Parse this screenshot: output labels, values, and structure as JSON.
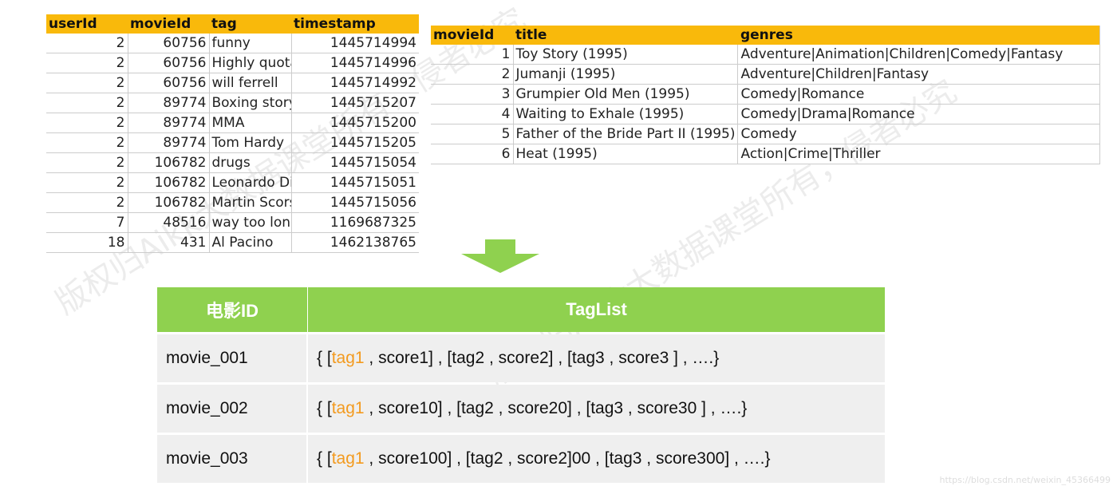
{
  "tags_table": {
    "headers": [
      "userId",
      "movieId",
      "tag",
      "timestamp"
    ],
    "rows": [
      [
        "2",
        "60756",
        "funny",
        "1445714994"
      ],
      [
        "2",
        "60756",
        "Highly quota",
        "1445714996"
      ],
      [
        "2",
        "60756",
        "will ferrell",
        "1445714992"
      ],
      [
        "2",
        "89774",
        "Boxing story",
        "1445715207"
      ],
      [
        "2",
        "89774",
        "MMA",
        "1445715200"
      ],
      [
        "2",
        "89774",
        "Tom Hardy",
        "1445715205"
      ],
      [
        "2",
        "106782",
        "drugs",
        "1445715054"
      ],
      [
        "2",
        "106782",
        "Leonardo Di",
        "1445715051"
      ],
      [
        "2",
        "106782",
        "Martin Scors",
        "1445715056"
      ],
      [
        "7",
        "48516",
        "way too long",
        "1169687325"
      ],
      [
        "18",
        "431",
        "Al Pacino",
        "1462138765"
      ]
    ]
  },
  "movies_table": {
    "headers": [
      "movieId",
      "title",
      "genres"
    ],
    "rows": [
      [
        "1",
        "Toy Story (1995)",
        "Adventure|Animation|Children|Comedy|Fantasy"
      ],
      [
        "2",
        "Jumanji (1995)",
        "Adventure|Children|Fantasy"
      ],
      [
        "3",
        "Grumpier Old Men (1995)",
        "Comedy|Romance"
      ],
      [
        "4",
        "Waiting to Exhale (1995)",
        "Comedy|Drama|Romance"
      ],
      [
        "5",
        "Father of the Bride Part II (1995)",
        "Comedy"
      ],
      [
        "6",
        "Heat (1995)",
        "Action|Crime|Thriller"
      ]
    ]
  },
  "taglist_table": {
    "headers": [
      "电影ID",
      "TagList"
    ],
    "rows": [
      {
        "id": "movie_001",
        "open": "{ [",
        "tag": "tag1",
        "rest": " , score1] , [tag2 , score2] , [tag3 , score3 ] , ….}"
      },
      {
        "id": "movie_002",
        "open": "{ [",
        "tag": "tag1",
        "rest": " , score10] , [tag2 , score20] , [tag3 , score30 ] , ….}"
      },
      {
        "id": "movie_003",
        "open": "{ [",
        "tag": "tag1",
        "rest": " , score100] , [tag2 , score2]00 , [tag3 , score300] , ….}"
      }
    ]
  },
  "watermark": "版权归Aikk大数据课堂所有，侵者必究",
  "url": "https://blog.csdn.net/weixin_45366499",
  "colors": {
    "header_orange": "#f9b90b",
    "header_green": "#8fd14f",
    "tag_highlight": "#f39a1e"
  }
}
